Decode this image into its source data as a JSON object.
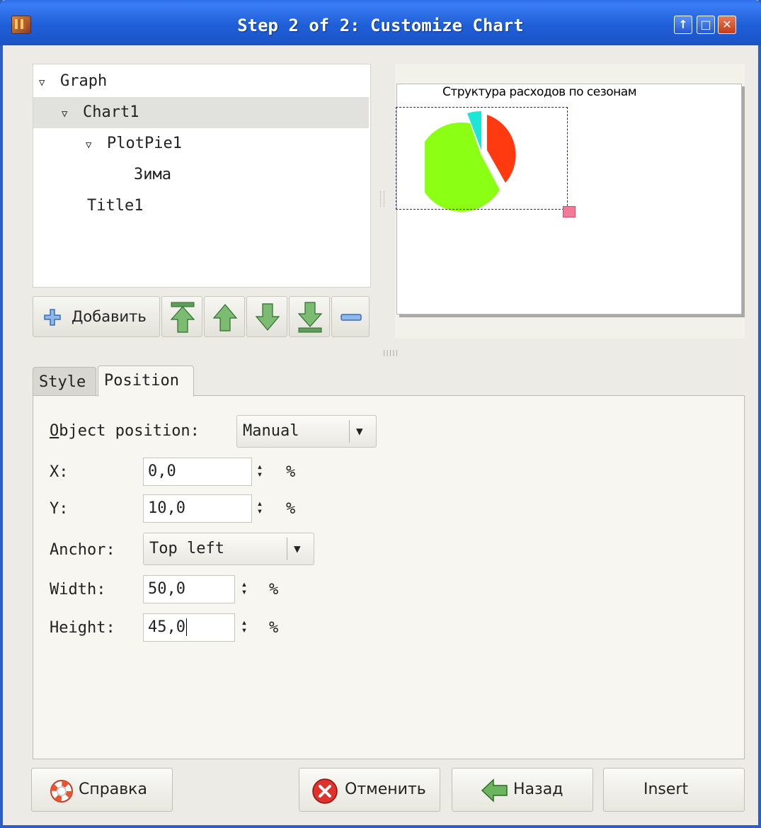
{
  "window": {
    "title": "Step 2 of 2: Customize Chart",
    "buttons": [
      "restore-up",
      "maximize",
      "close"
    ]
  },
  "tree": {
    "items": [
      {
        "label": "Graph",
        "level": 0,
        "expanded": true
      },
      {
        "label": "Chart1",
        "level": 1,
        "expanded": true,
        "selected": true
      },
      {
        "label": "PlotPie1",
        "level": 2,
        "expanded": true
      },
      {
        "label": "Зима",
        "level": 3
      },
      {
        "label": "Title1",
        "level": 1
      }
    ]
  },
  "toolbar": {
    "add_label": "Добавить",
    "buttons": [
      "move-top-icon",
      "move-up-icon",
      "move-down-icon",
      "move-bottom-icon",
      "remove-icon"
    ]
  },
  "preview": {
    "chart_title": "Структура расходов по сезонам",
    "colors": {
      "slice_red": "#ff3a10",
      "slice_green": "#8bff14",
      "slice_cyan": "#1ee6d6"
    }
  },
  "tabs": [
    {
      "label": "Style",
      "active": false
    },
    {
      "label": "Position",
      "active": true
    }
  ],
  "position": {
    "object_position_label": "Object position:",
    "object_position_value": "Manual",
    "x_label": "X:",
    "x_value": "0,0",
    "y_label": "Y:",
    "y_value": "10,0",
    "anchor_label": "Anchor:",
    "anchor_value": "Top left",
    "width_label": "Width:",
    "width_value": "50,0",
    "height_label": "Height:",
    "height_value": "45,0",
    "unit": "%"
  },
  "buttons": {
    "help": "Справка",
    "cancel": "Отменить",
    "back": "Назад",
    "insert": "Insert"
  }
}
